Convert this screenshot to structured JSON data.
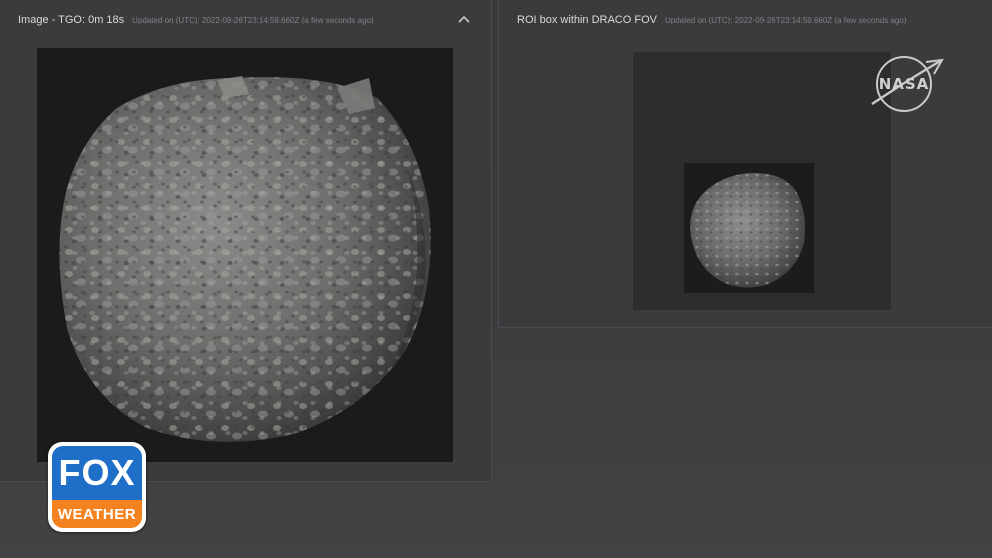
{
  "left_panel": {
    "title": "Image - TGO: 0m 18s",
    "updated": "Updated on (UTC): 2022-09-26T23:14:59.660Z (a few seconds ago)"
  },
  "right_panel": {
    "title": "ROI box within DRACO FOV",
    "updated": "Updated on (UTC): 2022-09-26T23:14:59.660Z (a few seconds ago)"
  },
  "icons": {
    "collapse": "chevron-up-icon",
    "nasa": "nasa-logo",
    "fox": "fox-weather-logo"
  },
  "logos": {
    "nasa_text": "NASA",
    "fox_top": "FOX",
    "fox_bottom": "WEATHER"
  },
  "colors": {
    "background": "#3a3b3d",
    "fox_blue": "#1f6fc8",
    "fox_orange": "#f4821f"
  }
}
